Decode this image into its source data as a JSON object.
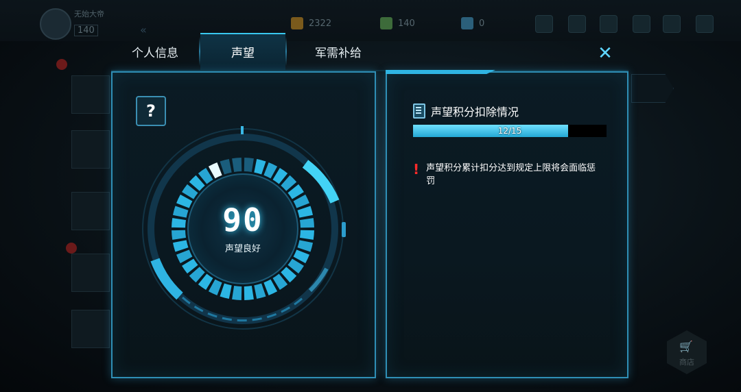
{
  "background": {
    "player_name": "无始大帝",
    "player_level": "140",
    "resources": [
      {
        "icon": "gold-crate-icon",
        "value": "2322",
        "color": "#7a5a1c"
      },
      {
        "icon": "green-crystal-icon",
        "value": "140",
        "color": "#3d6b3a"
      },
      {
        "icon": "blue-gem-icon",
        "value": "0",
        "color": "#2b5f7a"
      }
    ],
    "shop_label": "商店"
  },
  "tabs": [
    {
      "label": "个人信息"
    },
    {
      "label": "声望"
    },
    {
      "label": "军需补给"
    }
  ],
  "active_tab": 1,
  "close_label": "✕",
  "help_label": "?",
  "reputation": {
    "value": "90",
    "status": "声望良好",
    "level_fraction": 0.9
  },
  "deduction": {
    "title": "声望积分扣除情况",
    "current": 12,
    "max": 15,
    "progress_text": "12/15",
    "warning": "声望积分累计扣分达到规定上限将会面临惩罚"
  },
  "colors": {
    "accent": "#39c8ef",
    "warning": "#ff2a2a",
    "panel_border": "#2f8fb6"
  }
}
